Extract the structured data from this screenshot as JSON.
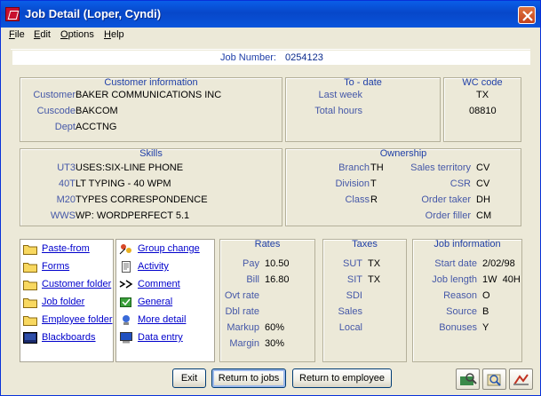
{
  "window": {
    "title": "Job Detail (Loper, Cyndi)"
  },
  "menu": [
    "File",
    "Edit",
    "Options",
    "Help"
  ],
  "job": {
    "label": "Job Number:",
    "value": "0254123"
  },
  "customer": {
    "heading": "Customer information",
    "customer_label": "Customer",
    "customer": "BAKER COMMUNICATIONS INC",
    "cuscode_label": "Cuscode",
    "cuscode": "BAKCOM",
    "dept_label": "Dept",
    "dept": "ACCTNG"
  },
  "todate": {
    "heading": "To - date",
    "last_week_label": "Last week",
    "total_hours_label": "Total hours"
  },
  "wc": {
    "heading": "WC code",
    "state": "TX",
    "code": "08810"
  },
  "skills": {
    "heading": "Skills",
    "items": [
      {
        "code": "UT3",
        "desc": "USES:SIX-LINE PHONE"
      },
      {
        "code": "40T",
        "desc": "LT TYPING - 40 WPM"
      },
      {
        "code": "M20",
        "desc": "TYPES CORRESPONDENCE"
      },
      {
        "code": "WWS",
        "desc": "WP: WORDPERFECT 5.1"
      }
    ]
  },
  "ownership": {
    "heading": "Ownership",
    "branch_label": "Branch",
    "branch": "TH",
    "division_label": "Division",
    "division": "T",
    "class_label": "Class",
    "class": "R",
    "sales_territory_label": "Sales territory",
    "sales_territory": "CV",
    "csr_label": "CSR",
    "csr": "CV",
    "order_taker_label": "Order taker",
    "order_taker": "DH",
    "order_filler_label": "Order filler",
    "order_filler": "CM"
  },
  "links_left": [
    {
      "label": "Paste-from",
      "icon": "folder-icon"
    },
    {
      "label": "Forms",
      "icon": "folder-icon"
    },
    {
      "label": "Customer folder",
      "icon": "folder-icon"
    },
    {
      "label": "Job folder",
      "icon": "folder-icon"
    },
    {
      "label": "Employee folder",
      "icon": "folder-icon"
    },
    {
      "label": "Blackboards",
      "icon": "blackboard-icon"
    }
  ],
  "links_right": [
    {
      "label": "Group change",
      "icon": "group-change-icon"
    },
    {
      "label": "Activity",
      "icon": "document-icon"
    },
    {
      "label": "Comment",
      "icon": "comment-icon"
    },
    {
      "label": "General",
      "icon": "general-icon"
    },
    {
      "label": "More detail",
      "icon": "more-detail-icon"
    },
    {
      "label": "Data entry",
      "icon": "computer-icon"
    }
  ],
  "rates": {
    "heading": "Rates",
    "pay_label": "Pay",
    "pay": "10.50",
    "bill_label": "Bill",
    "bill": "16.80",
    "ovt_label": "Ovt rate",
    "dbl_label": "Dbl rate",
    "markup_label": "Markup",
    "markup": "60%",
    "margin_label": "Margin",
    "margin": "30%"
  },
  "taxes": {
    "heading": "Taxes",
    "sut_label": "SUT",
    "sut": "TX",
    "sit_label": "SIT",
    "sit": "TX",
    "sdi_label": "SDI",
    "sales_label": "Sales",
    "local_label": "Local"
  },
  "jobinfo": {
    "heading": "Job information",
    "start_label": "Start date",
    "start": "2/02/98",
    "length_label": "Job length",
    "length": "1W  40H",
    "reason_label": "Reason",
    "reason": "O",
    "source_label": "Source",
    "source": "B",
    "bonuses_label": "Bonuses",
    "bonuses": "Y"
  },
  "buttons": {
    "exit": "Exit",
    "return_jobs": "Return to jobs",
    "return_employee": "Return to employee"
  }
}
